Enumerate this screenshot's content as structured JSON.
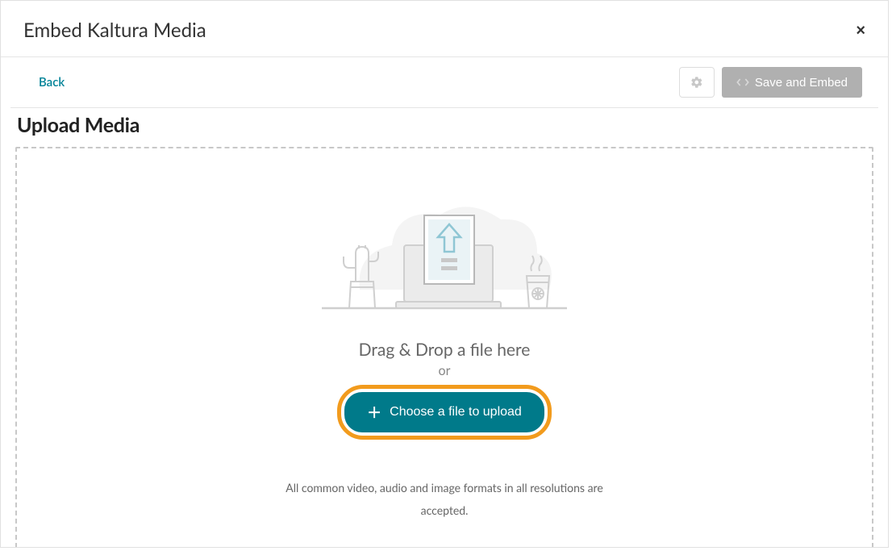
{
  "modal": {
    "title": "Embed Kaltura Media",
    "close_label": "×"
  },
  "toolbar": {
    "back_label": "Back",
    "settings_icon": "gear-icon",
    "save_embed_label": "Save and Embed"
  },
  "page": {
    "subtitle": "Upload Media"
  },
  "upload": {
    "drop_prompt": "Drag & Drop a file here",
    "or_label": "or",
    "choose_button_label": "Choose a file to upload",
    "accepted_text": "All common video, audio and image formats in all resolutions are accepted."
  },
  "colors": {
    "accent_teal": "#007a8a",
    "highlight_orange": "#f29b1d",
    "disabled_gray": "#b0b0b0"
  },
  "illustration": {
    "name": "upload-illustration",
    "elements": [
      "cactus",
      "laptop",
      "document-upload-arrow",
      "coffee-cup",
      "cloud"
    ]
  }
}
